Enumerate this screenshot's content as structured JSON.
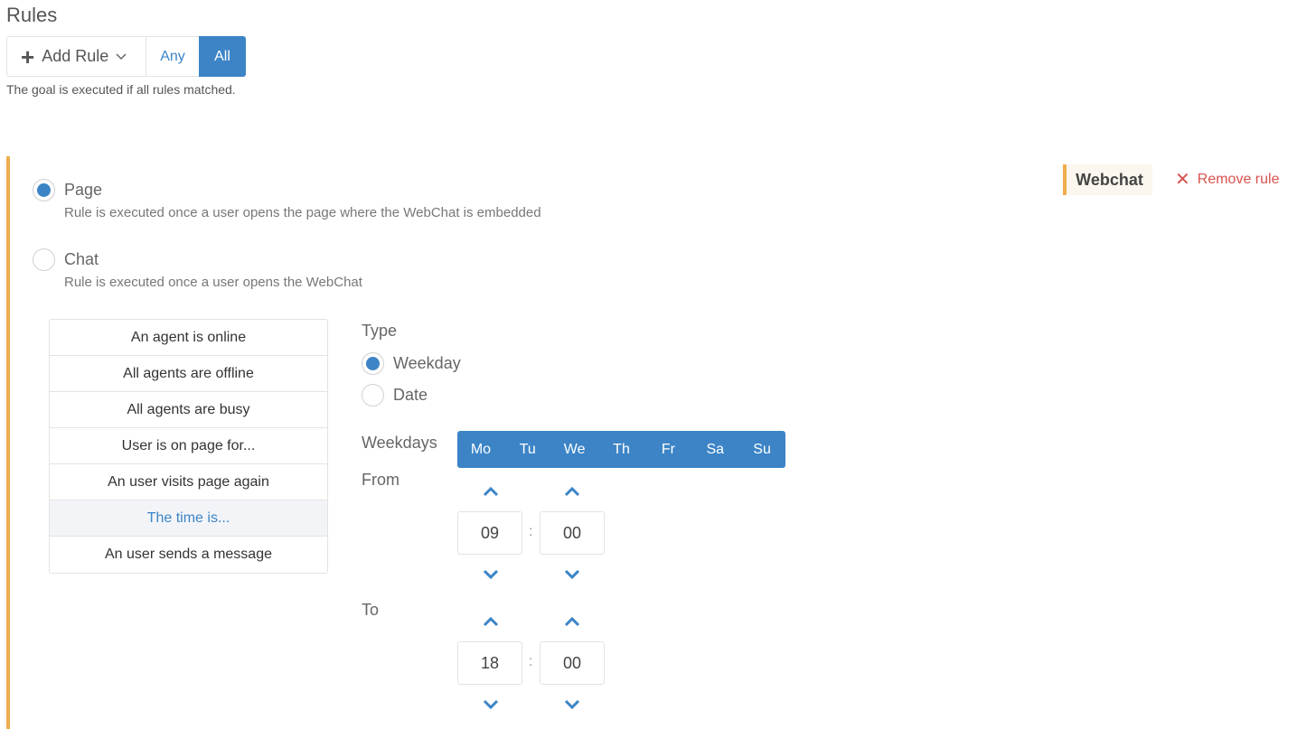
{
  "header": {
    "title": "Rules",
    "add_rule_label": "Add Rule",
    "any_label": "Any",
    "all_label": "All",
    "goal_description": "The goal is executed if all rules matched."
  },
  "rule": {
    "badge": "Webchat",
    "remove_label": "Remove rule",
    "trigger_options": [
      {
        "label": "Page",
        "description": "Rule is executed once a user opens the page where the WebChat is embedded",
        "checked": true
      },
      {
        "label": "Chat",
        "description": "Rule is executed once a user opens the WebChat",
        "checked": false
      }
    ],
    "conditions": [
      "An agent is online",
      "All agents are offline",
      "All agents are busy",
      "User is on page for...",
      "An user visits page again",
      "The time is...",
      "An user sends a message"
    ],
    "active_condition": "The time is...",
    "type": {
      "label": "Type",
      "options": [
        {
          "label": "Weekday",
          "checked": true
        },
        {
          "label": "Date",
          "checked": false
        }
      ]
    },
    "weekdays": {
      "label": "Weekdays",
      "days": [
        "Mo",
        "Tu",
        "We",
        "Th",
        "Fr",
        "Sa",
        "Su"
      ]
    },
    "from": {
      "label": "From",
      "hour": "09",
      "minute": "00"
    },
    "to": {
      "label": "To",
      "hour": "18",
      "minute": "00"
    },
    "separator": ":"
  },
  "colors": {
    "accent": "#3c84c6",
    "rule_border": "#f0ad4e",
    "danger": "#d9534f"
  },
  "icons": {
    "add": "plus-icon",
    "dropdown": "chevron-down-icon",
    "remove": "close-icon",
    "increment": "chevron-up-icon",
    "decrement": "chevron-down-icon"
  }
}
